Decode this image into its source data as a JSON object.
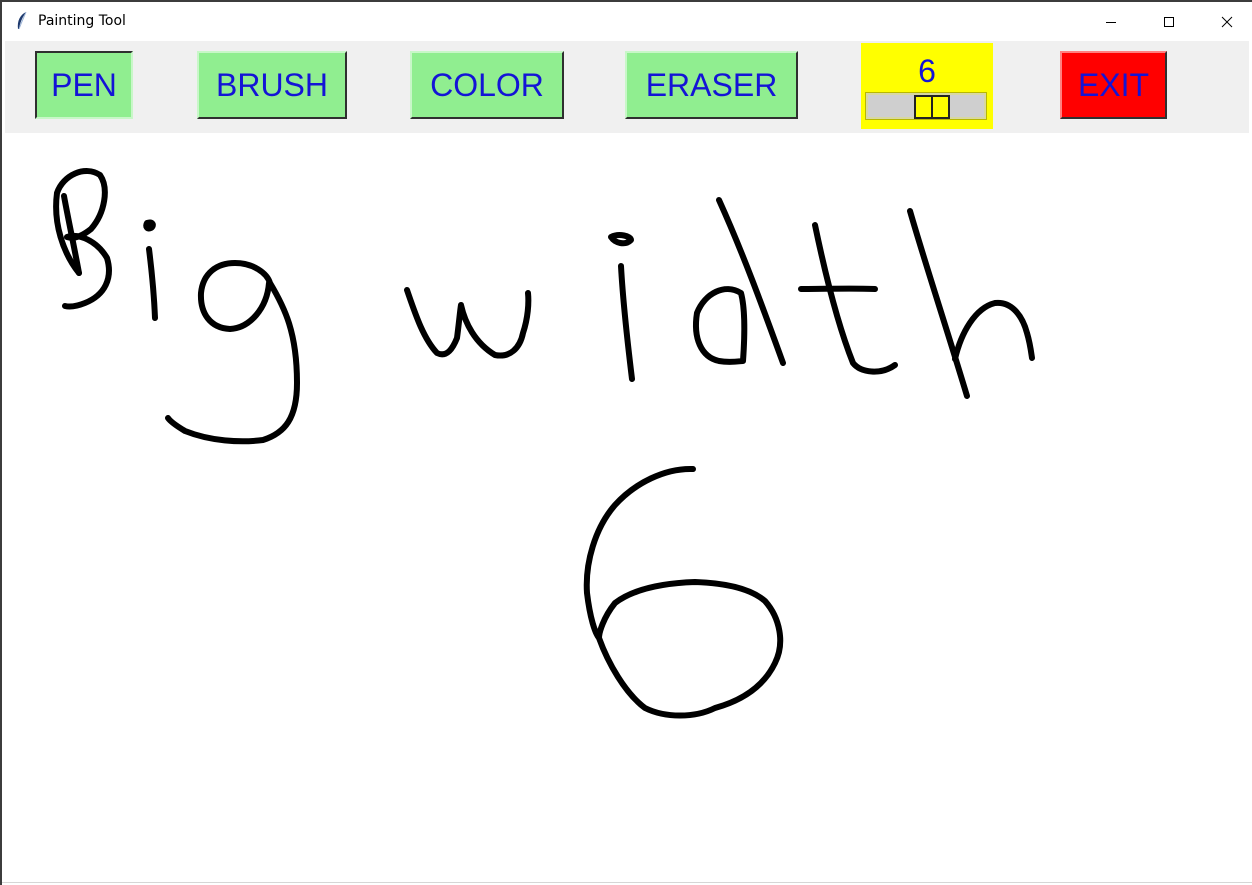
{
  "window": {
    "title": "Painting Tool"
  },
  "toolbar": {
    "pen_label": "PEN",
    "brush_label": "BRUSH",
    "color_label": "COLOR",
    "eraser_label": "ERASER",
    "exit_label": "EXIT",
    "active_tool": "pen"
  },
  "width_control": {
    "value": "6"
  },
  "colors": {
    "tool_button": "#90ee90",
    "tool_text": "#1414d6",
    "exit_button": "#ff0000",
    "width_panel": "#ffff00",
    "stroke": "#000000"
  },
  "icons": {
    "app": "feather-icon",
    "minimize": "minimize-icon",
    "maximize": "maximize-icon",
    "close": "close-icon"
  }
}
